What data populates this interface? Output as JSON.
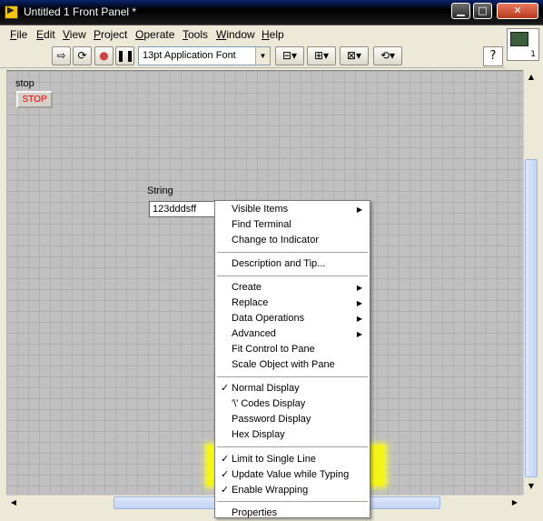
{
  "window": {
    "title": "Untitled 1 Front Panel *"
  },
  "menu": [
    {
      "label": "File",
      "u": "F",
      "rest": "ile"
    },
    {
      "label": "Edit",
      "u": "E",
      "rest": "dit"
    },
    {
      "label": "View",
      "u": "V",
      "rest": "iew"
    },
    {
      "label": "Project",
      "u": "P",
      "rest": "roject"
    },
    {
      "label": "Operate",
      "u": "O",
      "rest": "perate"
    },
    {
      "label": "Tools",
      "u": "T",
      "rest": "ools"
    },
    {
      "label": "Window",
      "u": "W",
      "rest": "indow"
    },
    {
      "label": "Help",
      "u": "H",
      "rest": "elp"
    }
  ],
  "toolbar": {
    "font": "13pt Application Font",
    "help": "?"
  },
  "context_help": {
    "number": "1"
  },
  "panel": {
    "stop_label": "stop",
    "stop_button": "STOP",
    "string_label": "String",
    "string_value": "123dddsff"
  },
  "context_menu": {
    "items": [
      {
        "label": "Visible Items",
        "submenu": true
      },
      {
        "label": "Find Terminal"
      },
      {
        "label": "Change to Indicator"
      },
      {
        "label": "Description and Tip..."
      },
      {
        "label": "Create",
        "submenu": true
      },
      {
        "label": "Replace",
        "submenu": true
      },
      {
        "label": "Data Operations",
        "submenu": true
      },
      {
        "label": "Advanced",
        "submenu": true
      },
      {
        "label": "Fit Control to Pane"
      },
      {
        "label": "Scale Object with Pane"
      },
      {
        "label": "Normal Display",
        "checked": true
      },
      {
        "label": "'\\' Codes Display"
      },
      {
        "label": "Password Display"
      },
      {
        "label": "Hex Display"
      },
      {
        "label": "Limit to Single Line",
        "checked": true
      },
      {
        "label": "Update Value while Typing",
        "checked": true
      },
      {
        "label": "Enable Wrapping",
        "checked": true
      },
      {
        "label": "Properties"
      }
    ],
    "check_glyph": "✓",
    "submenu_glyph": "▶"
  }
}
